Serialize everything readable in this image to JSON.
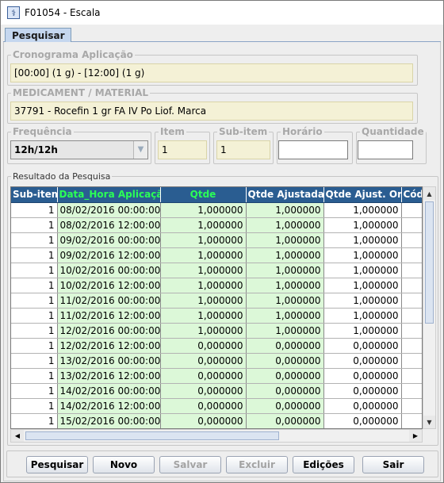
{
  "window": {
    "title": "F01054 - Escala"
  },
  "tabs": [
    {
      "label": "Pesquisar"
    }
  ],
  "cronograma": {
    "legend": "Cronograma Aplicação",
    "value": "[00:00] (1 g) - [12:00] (1 g)"
  },
  "medicamento": {
    "legend": "MEDICAMENT / MATERIAL",
    "value": "37791 - Rocefin   1 gr  FA  IV Po Liof.   Marca"
  },
  "frequencia": {
    "legend": "Frequência",
    "value": "12h/12h"
  },
  "item": {
    "legend": "Item",
    "value": "1"
  },
  "subitem": {
    "legend": "Sub-item",
    "value": "1"
  },
  "horario": {
    "legend": "Horário",
    "value": ""
  },
  "quantidade": {
    "legend": "Quantidade",
    "value": ""
  },
  "results": {
    "legend": "Resultado da Pesquisa",
    "columns": [
      "Sub-item",
      "Data_Hora Aplicação",
      "Qtde",
      "Qtde Ajustada",
      "Qtde Ajust. Orig.",
      "Cód"
    ],
    "rows": [
      [
        "1",
        "08/02/2016 00:00:00",
        "1,000000",
        "1,000000",
        "1,000000"
      ],
      [
        "1",
        "08/02/2016 12:00:00",
        "1,000000",
        "1,000000",
        "1,000000"
      ],
      [
        "1",
        "09/02/2016 00:00:00",
        "1,000000",
        "1,000000",
        "1,000000"
      ],
      [
        "1",
        "09/02/2016 12:00:00",
        "1,000000",
        "1,000000",
        "1,000000"
      ],
      [
        "1",
        "10/02/2016 00:00:00",
        "1,000000",
        "1,000000",
        "1,000000"
      ],
      [
        "1",
        "10/02/2016 12:00:00",
        "1,000000",
        "1,000000",
        "1,000000"
      ],
      [
        "1",
        "11/02/2016 00:00:00",
        "1,000000",
        "1,000000",
        "1,000000"
      ],
      [
        "1",
        "11/02/2016 12:00:00",
        "1,000000",
        "1,000000",
        "1,000000"
      ],
      [
        "1",
        "12/02/2016 00:00:00",
        "1,000000",
        "1,000000",
        "1,000000"
      ],
      [
        "1",
        "12/02/2016 12:00:00",
        "0,000000",
        "0,000000",
        "0,000000"
      ],
      [
        "1",
        "13/02/2016 00:00:00",
        "0,000000",
        "0,000000",
        "0,000000"
      ],
      [
        "1",
        "13/02/2016 12:00:00",
        "0,000000",
        "0,000000",
        "0,000000"
      ],
      [
        "1",
        "14/02/2016 00:00:00",
        "0,000000",
        "0,000000",
        "0,000000"
      ],
      [
        "1",
        "14/02/2016 12:00:00",
        "0,000000",
        "0,000000",
        "0,000000"
      ],
      [
        "1",
        "15/02/2016 00:00:00",
        "0,000000",
        "0,000000",
        "0,000000"
      ]
    ]
  },
  "buttons": {
    "pesquisar": "Pesquisar",
    "novo": "Novo",
    "salvar": "Salvar",
    "excluir": "Excluir",
    "edicoes": "Edições",
    "sair": "Sair"
  },
  "colors": {
    "header_bg": "#2a5d91",
    "highlight_header_text": "#2bff56",
    "row_green": "#dcf8d8",
    "readonly_field": "#f4f1d6"
  }
}
